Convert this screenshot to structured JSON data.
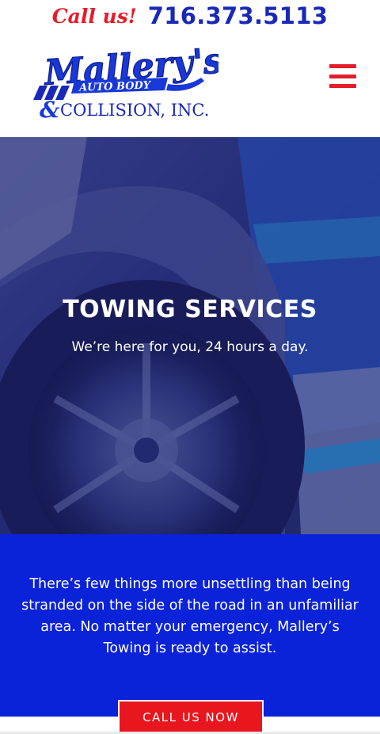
{
  "topbar": {
    "call_label": "Call us!",
    "phone": "716.373.5113"
  },
  "logo": {
    "name": "Mallery's",
    "line1": "AUTO BODY",
    "line2": "COLLISION, INC.",
    "ampersand": "&"
  },
  "header": {
    "menu_icon": "hamburger-menu-icon"
  },
  "hero": {
    "title": "TOWING SERVICES",
    "subtitle": "We’re here for you, 24 hours a day."
  },
  "intro": {
    "text": "There’s few things more unsettling than being stranded on the side of the road in an unfamiliar area. No matter your emergency, Mallery’s Towing is ready to assist."
  },
  "cta": {
    "label": "CALL US NOW"
  },
  "colors": {
    "brand_red": "#e31d2b",
    "brand_blue": "#1828b8",
    "section_blue": "#0a22d8",
    "cta_red": "#e8161f"
  }
}
